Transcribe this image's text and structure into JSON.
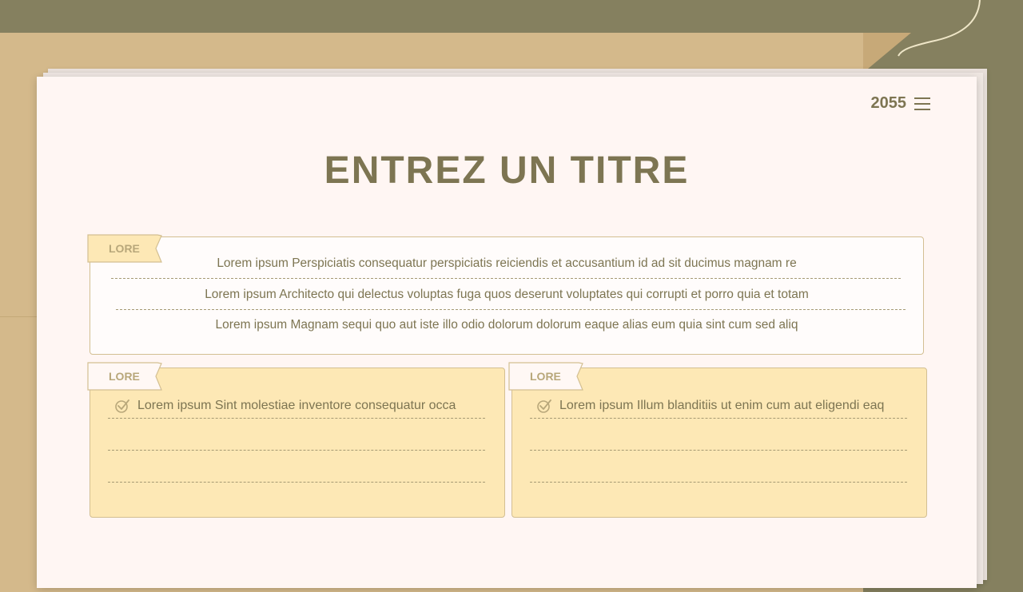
{
  "page_number": "2055",
  "title": "ENTREZ UN TITRE",
  "top_card": {
    "tag": "LORE",
    "lines": [
      "Lorem ipsum Perspiciatis consequatur perspiciatis reiciendis et accusantium id ad sit ducimus magnam re",
      "Lorem ipsum Architecto qui delectus voluptas fuga quos deserunt voluptates qui corrupti et porro quia et totam",
      "Lorem ipsum Magnam sequi quo aut iste illo odio dolorum dolorum eaque alias eum quia sint cum sed aliq"
    ]
  },
  "left_card": {
    "tag": "LORE",
    "item": "Lorem ipsum Sint molestiae inventore consequatur occa"
  },
  "right_card": {
    "tag": "LORE",
    "item": "Lorem ipsum Illum blanditiis ut enim cum aut eligendi eaq"
  },
  "colors": {
    "background": "#85805f",
    "folder": "#d4b98b",
    "sheet": "#fff6f3",
    "text": "#7d7552",
    "card_yellow": "#fde8b5",
    "border": "#d3bf92"
  },
  "icons": [
    "hamburger-menu-icon",
    "check-icon"
  ]
}
